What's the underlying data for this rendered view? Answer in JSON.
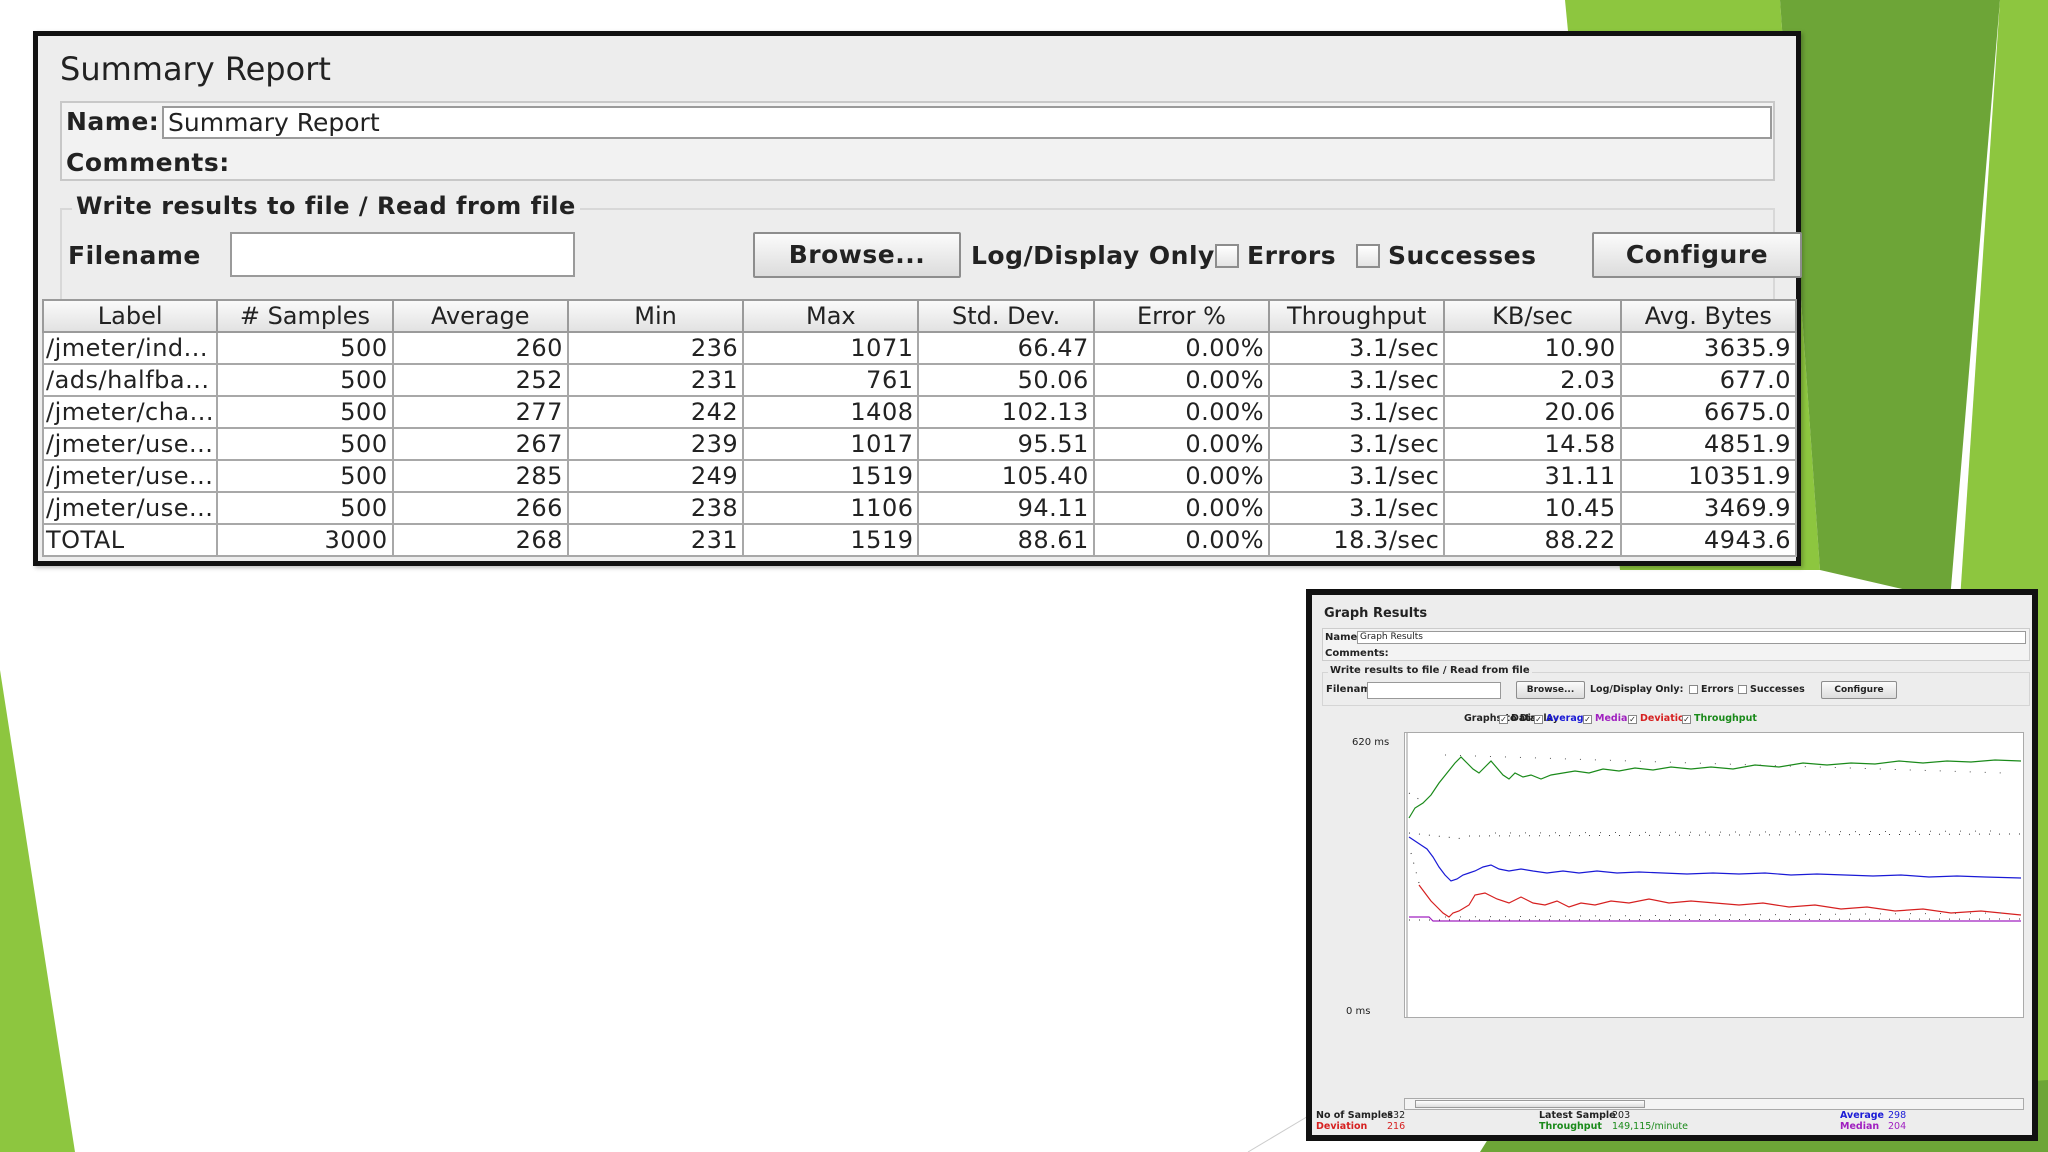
{
  "summary_report": {
    "title": "Summary Report",
    "name_label": "Name:",
    "name_value": "Summary Report",
    "comments_label": "Comments:",
    "file_section_title": "Write results to file / Read from file",
    "filename_label": "Filename",
    "filename_value": "",
    "browse_label": "Browse...",
    "log_display_label": "Log/Display Only:",
    "errors_label": "Errors",
    "successes_label": "Successes",
    "errors_checked": false,
    "successes_checked": false,
    "configure_label": "Configure",
    "columns": [
      "Label",
      "# Samples",
      "Average",
      "Min",
      "Max",
      "Std. Dev.",
      "Error %",
      "Throughput",
      "KB/sec",
      "Avg. Bytes"
    ],
    "rows": [
      [
        "/jmeter/ind...",
        "500",
        "260",
        "236",
        "1071",
        "66.47",
        "0.00%",
        "3.1/sec",
        "10.90",
        "3635.9"
      ],
      [
        "/ads/halfba...",
        "500",
        "252",
        "231",
        "761",
        "50.06",
        "0.00%",
        "3.1/sec",
        "2.03",
        "677.0"
      ],
      [
        "/jmeter/cha...",
        "500",
        "277",
        "242",
        "1408",
        "102.13",
        "0.00%",
        "3.1/sec",
        "20.06",
        "6675.0"
      ],
      [
        "/jmeter/use...",
        "500",
        "267",
        "239",
        "1017",
        "95.51",
        "0.00%",
        "3.1/sec",
        "14.58",
        "4851.9"
      ],
      [
        "/jmeter/use...",
        "500",
        "285",
        "249",
        "1519",
        "105.40",
        "0.00%",
        "3.1/sec",
        "31.11",
        "10351.9"
      ],
      [
        "/jmeter/use...",
        "500",
        "266",
        "238",
        "1106",
        "94.11",
        "0.00%",
        "3.1/sec",
        "10.45",
        "3469.9"
      ],
      [
        "TOTAL",
        "3000",
        "268",
        "231",
        "1519",
        "88.61",
        "0.00%",
        "18.3/sec",
        "88.22",
        "4943.6"
      ]
    ]
  },
  "graph_results": {
    "title": "Graph Results",
    "name_label": "Name:",
    "name_value": "Graph Results",
    "comments_label": "Comments:",
    "file_section_title": "Write results to file / Read from file",
    "filename_label": "Filename",
    "browse_label": "Browse...",
    "log_display_label": "Log/Display Only:",
    "errors_label": "Errors",
    "successes_label": "Successes",
    "configure_label": "Configure",
    "graphs_to_display_label": "Graphs to Display",
    "toggles": [
      {
        "label": "Data",
        "checked": true,
        "color": "#222222"
      },
      {
        "label": "Average",
        "checked": true,
        "color": "#1a1ad6"
      },
      {
        "label": "Median",
        "checked": true,
        "color": "#a020c0"
      },
      {
        "label": "Deviation",
        "checked": true,
        "color": "#d62020"
      },
      {
        "label": "Throughput",
        "checked": true,
        "color": "#1a8a1a"
      }
    ],
    "y_max_label": "620 ms",
    "y_min_label": "0 ms",
    "stats": {
      "no_of_samples_label": "No of Samples",
      "no_of_samples": "832",
      "latest_sample_label": "Latest Sample",
      "latest_sample": "203",
      "average_label": "Average",
      "average": "298",
      "deviation_label": "Deviation",
      "deviation": "216",
      "throughput_label": "Throughput",
      "throughput": "149,115/minute",
      "median_label": "Median",
      "median": "204"
    }
  }
}
